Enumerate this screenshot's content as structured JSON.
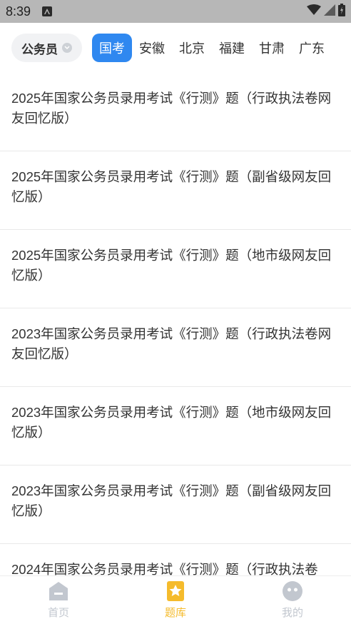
{
  "status_bar": {
    "time": "8:39"
  },
  "filter": {
    "category": "公务员",
    "tabs": [
      {
        "label": "国考",
        "active": true
      },
      {
        "label": "安徽",
        "active": false
      },
      {
        "label": "北京",
        "active": false
      },
      {
        "label": "福建",
        "active": false
      },
      {
        "label": "甘肃",
        "active": false
      },
      {
        "label": "广东",
        "active": false
      }
    ]
  },
  "papers": [
    {
      "title": "2025年国家公务员录用考试《行测》题（行政执法卷网友回忆版）"
    },
    {
      "title": "2025年国家公务员录用考试《行测》题（副省级网友回忆版）"
    },
    {
      "title": "2025年国家公务员录用考试《行测》题（地市级网友回忆版）"
    },
    {
      "title": "2023年国家公务员录用考试《行测》题（行政执法卷网友回忆版）"
    },
    {
      "title": "2023年国家公务员录用考试《行测》题（地市级网友回忆版）"
    },
    {
      "title": "2023年国家公务员录用考试《行测》题（副省级网友回忆版）"
    },
    {
      "title": "2024年国家公务员录用考试《行测》题（行政执法卷"
    }
  ],
  "bottom_nav": [
    {
      "label": "首页",
      "icon": "home-icon",
      "active": false
    },
    {
      "label": "题库",
      "icon": "question-bank-icon",
      "active": true
    },
    {
      "label": "我的",
      "icon": "profile-icon",
      "active": false
    }
  ],
  "colors": {
    "accent": "#2f88f0",
    "nav_active": "#f5bb2c",
    "nav_inactive": "#c2c7cf"
  }
}
